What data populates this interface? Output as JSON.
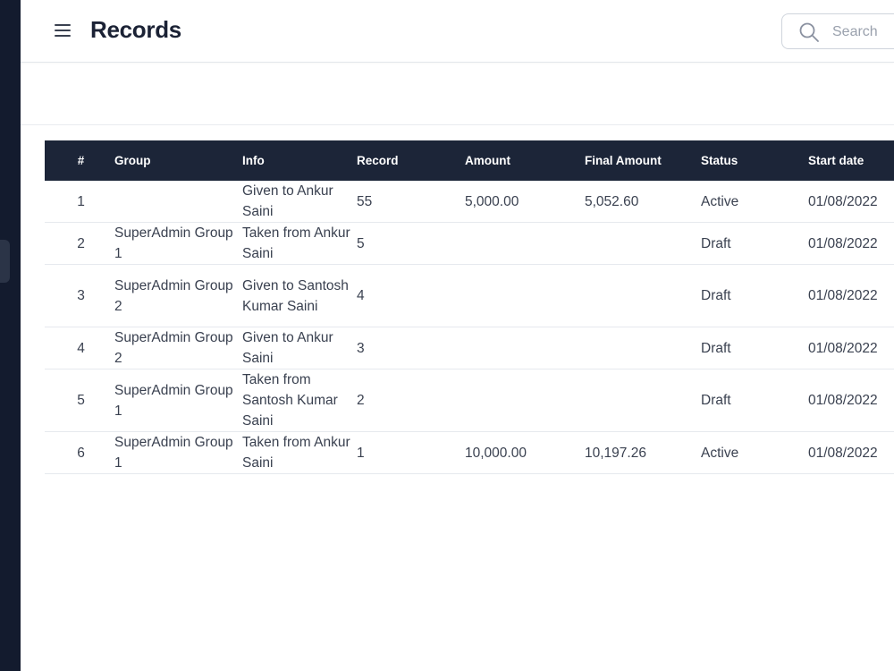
{
  "header": {
    "title": "Records",
    "search": {
      "placeholder": "Search",
      "value": ""
    },
    "menu_icon": "hamburger-menu-icon",
    "search_icon": "search-icon"
  },
  "table": {
    "columns": [
      "#",
      "Group",
      "Info",
      "Record",
      "Amount",
      "Final Amount",
      "Status",
      "Start date"
    ],
    "rows": [
      {
        "num": "1",
        "group": "",
        "info": "Given to Ankur Saini",
        "record": "55",
        "amount": "5,000.00",
        "final_amount": "5,052.60",
        "status": "Active",
        "start_date": "01/08/2022"
      },
      {
        "num": "2",
        "group": "SuperAdmin Group 1",
        "info": "Taken from Ankur Saini",
        "record": "5",
        "amount": "",
        "final_amount": "",
        "status": "Draft",
        "start_date": "01/08/2022"
      },
      {
        "num": "3",
        "group": "SuperAdmin Group 2",
        "info": "Given to Santosh Kumar Saini",
        "record": "4",
        "amount": "",
        "final_amount": "",
        "status": "Draft",
        "start_date": "01/08/2022"
      },
      {
        "num": "4",
        "group": "SuperAdmin Group 2",
        "info": "Given to Ankur Saini",
        "record": "3",
        "amount": "",
        "final_amount": "",
        "status": "Draft",
        "start_date": "01/08/2022"
      },
      {
        "num": "5",
        "group": "SuperAdmin Group 1",
        "info": "Taken from Santosh Kumar Saini",
        "record": "2",
        "amount": "",
        "final_amount": "",
        "status": "Draft",
        "start_date": "01/08/2022"
      },
      {
        "num": "6",
        "group": "SuperAdmin Group 1",
        "info": "Taken from Ankur Saini",
        "record": "1",
        "amount": "10,000.00",
        "final_amount": "10,197.26",
        "status": "Active",
        "start_date": "01/08/2022"
      }
    ]
  },
  "colors": {
    "sidebar": "#131b2e",
    "table_header": "#1c2538",
    "title": "#1b2235"
  }
}
